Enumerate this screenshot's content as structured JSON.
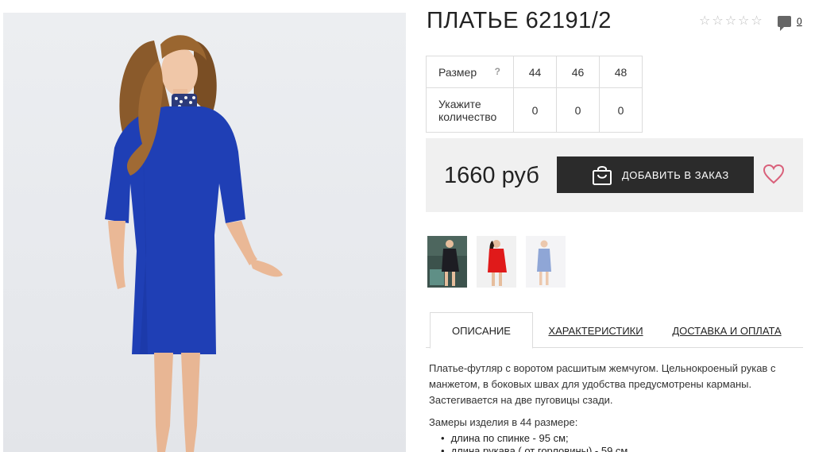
{
  "product": {
    "title": "ПЛАТЬЕ 62191/2",
    "rating_icon": "star-outline-icon",
    "comments_count": "0"
  },
  "size_table": {
    "size_label": "Размер",
    "help_label": "?",
    "quantity_label": "Укажите количество",
    "sizes": [
      "44",
      "46",
      "48"
    ],
    "quantities": [
      "0",
      "0",
      "0"
    ]
  },
  "purchase": {
    "price": "1660 руб",
    "add_button_label": "ДОБАВИТЬ В ЗАКАЗ",
    "button_color": "#2b2b2b",
    "heart_color": "#d9607a"
  },
  "thumbnails": [
    {
      "dress_color": "#1d1d23"
    },
    {
      "dress_color": "#e01a1a"
    },
    {
      "dress_color": "#8fa6d6"
    }
  ],
  "tabs": [
    {
      "label": "ОПИСАНИЕ",
      "active": true
    },
    {
      "label": "ХАРАКТЕРИСТИКИ",
      "active": false
    },
    {
      "label": "ДОСТАВКА И ОПЛАТА",
      "active": false
    }
  ],
  "description": {
    "text": "Платье-футляр с воротом расшитым жемчугом. Цельнокроеный рукав с манжетом, в боковых швах для удобства предусмотрены карманы. Застегивается на две пуговицы сзади.",
    "measurements_title": "Замеры изделия в 44 размере:",
    "measurements": [
      "длина по спинке - 95 см;",
      "длина рукава ( от горловины) - 59 см"
    ]
  },
  "main_photo": {
    "dress_color": "#1f3fb5"
  }
}
